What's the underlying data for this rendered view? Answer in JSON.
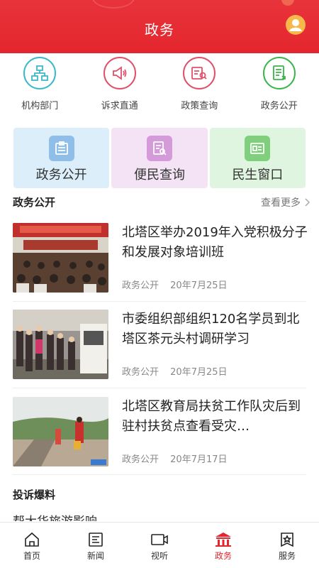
{
  "header": {
    "title": "政务"
  },
  "quick": [
    {
      "label": "机构部门",
      "color": "#3cb8c8",
      "icon": "org-chart-icon"
    },
    {
      "label": "诉求直通",
      "color": "#e0506a",
      "icon": "megaphone-icon"
    },
    {
      "label": "政策查询",
      "color": "#e0506a",
      "icon": "policy-search-icon"
    },
    {
      "label": "政务公开",
      "color": "#3bb54a",
      "icon": "document-icon"
    }
  ],
  "cards": [
    {
      "label": "政务公开",
      "bg": "#dbeefa",
      "icbg": "#8fbfe8",
      "icon": "notice-board-icon"
    },
    {
      "label": "便民查询",
      "bg": "#f3e3f4",
      "icbg": "#d59ad9",
      "icon": "search-doc-icon"
    },
    {
      "label": "民生窗口",
      "bg": "#e0f5df",
      "icbg": "#7fcf7d",
      "icon": "id-card-icon"
    }
  ],
  "section": {
    "title": "政务公开",
    "more": "查看更多"
  },
  "news": [
    {
      "title": "北塔区举办2019年入党积极分子和发展对象培训班",
      "source": "政务公开",
      "date": "20年7月25日"
    },
    {
      "title": "市委组织部组织120名学员到北塔区茶元头村调研学习",
      "source": "政务公开",
      "date": "20年7月25日"
    },
    {
      "title": "北塔区教育局扶贫工作队灾后到驻村扶贫点查看受灾…",
      "source": "政务公开",
      "date": "20年7月17日"
    }
  ],
  "section2": {
    "title": "投诉爆料",
    "peek": "帮大华旅游影响"
  },
  "nav": [
    {
      "label": "首页",
      "icon": "home-icon"
    },
    {
      "label": "新闻",
      "icon": "news-icon"
    },
    {
      "label": "视听",
      "icon": "video-icon"
    },
    {
      "label": "政务",
      "icon": "government-icon",
      "active": true
    },
    {
      "label": "服务",
      "icon": "service-icon"
    }
  ],
  "colors": {
    "brand": "#e4262e"
  }
}
